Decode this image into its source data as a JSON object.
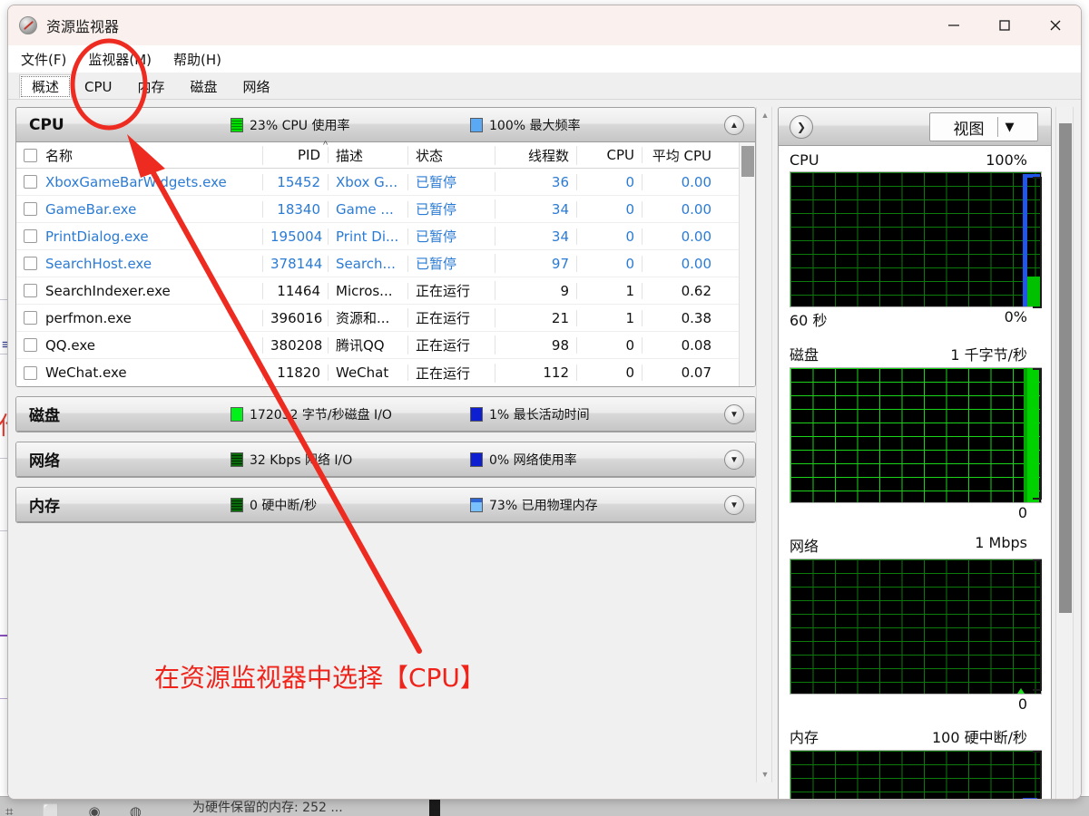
{
  "window": {
    "title": "资源监视器",
    "app_icon": "resource-monitor-icon",
    "minimize": "—",
    "maximize": "□",
    "close": "✕"
  },
  "menu": [
    {
      "label": "文件(F)"
    },
    {
      "label": "监视器(M)"
    },
    {
      "label": "帮助(H)"
    }
  ],
  "tabs": [
    {
      "label": "概述",
      "selected": true
    },
    {
      "label": "CPU",
      "selected": false
    },
    {
      "label": "内存",
      "selected": false
    },
    {
      "label": "磁盘",
      "selected": false
    },
    {
      "label": "网络",
      "selected": false
    }
  ],
  "sections": {
    "cpu": {
      "title": "CPU",
      "stat1": "23% CPU 使用率",
      "stat2": "100% 最大频率",
      "expanded": true,
      "chevron": "▲",
      "columns": [
        "名称",
        "PID",
        "描述",
        "状态",
        "线程数",
        "CPU",
        "平均 CPU"
      ],
      "rows": [
        {
          "name": "XboxGameBarWidgets.exe",
          "pid": "15452",
          "desc": "Xbox G...",
          "status": "已暂停",
          "threads": "36",
          "cpu": "0",
          "avg": "0.00",
          "suspended": true
        },
        {
          "name": "GameBar.exe",
          "pid": "18340",
          "desc": "Game ...",
          "status": "已暂停",
          "threads": "34",
          "cpu": "0",
          "avg": "0.00",
          "suspended": true
        },
        {
          "name": "PrintDialog.exe",
          "pid": "195004",
          "desc": "Print Di...",
          "status": "已暂停",
          "threads": "34",
          "cpu": "0",
          "avg": "0.00",
          "suspended": true
        },
        {
          "name": "SearchHost.exe",
          "pid": "378144",
          "desc": "Search...",
          "status": "已暂停",
          "threads": "97",
          "cpu": "0",
          "avg": "0.00",
          "suspended": true
        },
        {
          "name": "SearchIndexer.exe",
          "pid": "11464",
          "desc": "Micros...",
          "status": "正在运行",
          "threads": "9",
          "cpu": "1",
          "avg": "0.62",
          "suspended": false
        },
        {
          "name": "perfmon.exe",
          "pid": "396016",
          "desc": "资源和...",
          "status": "正在运行",
          "threads": "21",
          "cpu": "1",
          "avg": "0.38",
          "suspended": false
        },
        {
          "name": "QQ.exe",
          "pid": "380208",
          "desc": "腾讯QQ",
          "status": "正在运行",
          "threads": "98",
          "cpu": "0",
          "avg": "0.08",
          "suspended": false
        },
        {
          "name": "WeChat.exe",
          "pid": "11820",
          "desc": "WeChat",
          "status": "正在运行",
          "threads": "112",
          "cpu": "0",
          "avg": "0.07",
          "suspended": false
        }
      ]
    },
    "disk": {
      "title": "磁盘",
      "stat1": "172032 字节/秒磁盘 I/O",
      "stat2": "1% 最长活动时间",
      "chevron": "▼"
    },
    "network": {
      "title": "网络",
      "stat1": "32 Kbps 网络 I/O",
      "stat2": "0% 网络使用率",
      "chevron": "▼"
    },
    "memory": {
      "title": "内存",
      "stat1": "0 硬中断/秒",
      "stat2": "73% 已用物理内存",
      "chevron": "▼"
    }
  },
  "right_panel": {
    "expand_icon": "chevron-right-icon",
    "view_button": "视图",
    "view_caret": "▼",
    "graphs": [
      {
        "name": "CPU",
        "top_right": "100%",
        "bottom_left": "60 秒",
        "bottom_right": "0%"
      },
      {
        "name": "磁盘",
        "top_right": "1 千字节/秒",
        "bottom_left": "",
        "bottom_right": "0"
      },
      {
        "name": "网络",
        "top_right": "1 Mbps",
        "bottom_left": "",
        "bottom_right": "0"
      },
      {
        "name": "内存",
        "top_right": "100 硬中断/秒",
        "bottom_left": "",
        "bottom_right": ""
      }
    ]
  },
  "annotation": {
    "text": "在资源监视器中选择【CPU】",
    "color": "#f0231b",
    "circle_target": "监视器(M) / CPU tab area",
    "arrow_target": "CPU section header"
  },
  "background": {
    "red_text": "作源测",
    "bottom_text": "为硬件保留的内存:  252 ..."
  },
  "colors": {
    "titlebar": "#faf0ee",
    "accent_blue": "#2b7bd4",
    "annotation_red": "#f0231b",
    "graph_bg": "#000000",
    "graph_grid": "#0b7a0b",
    "cpu_usage_green": "#00c000",
    "max_freq_blue": "#2156e8"
  }
}
